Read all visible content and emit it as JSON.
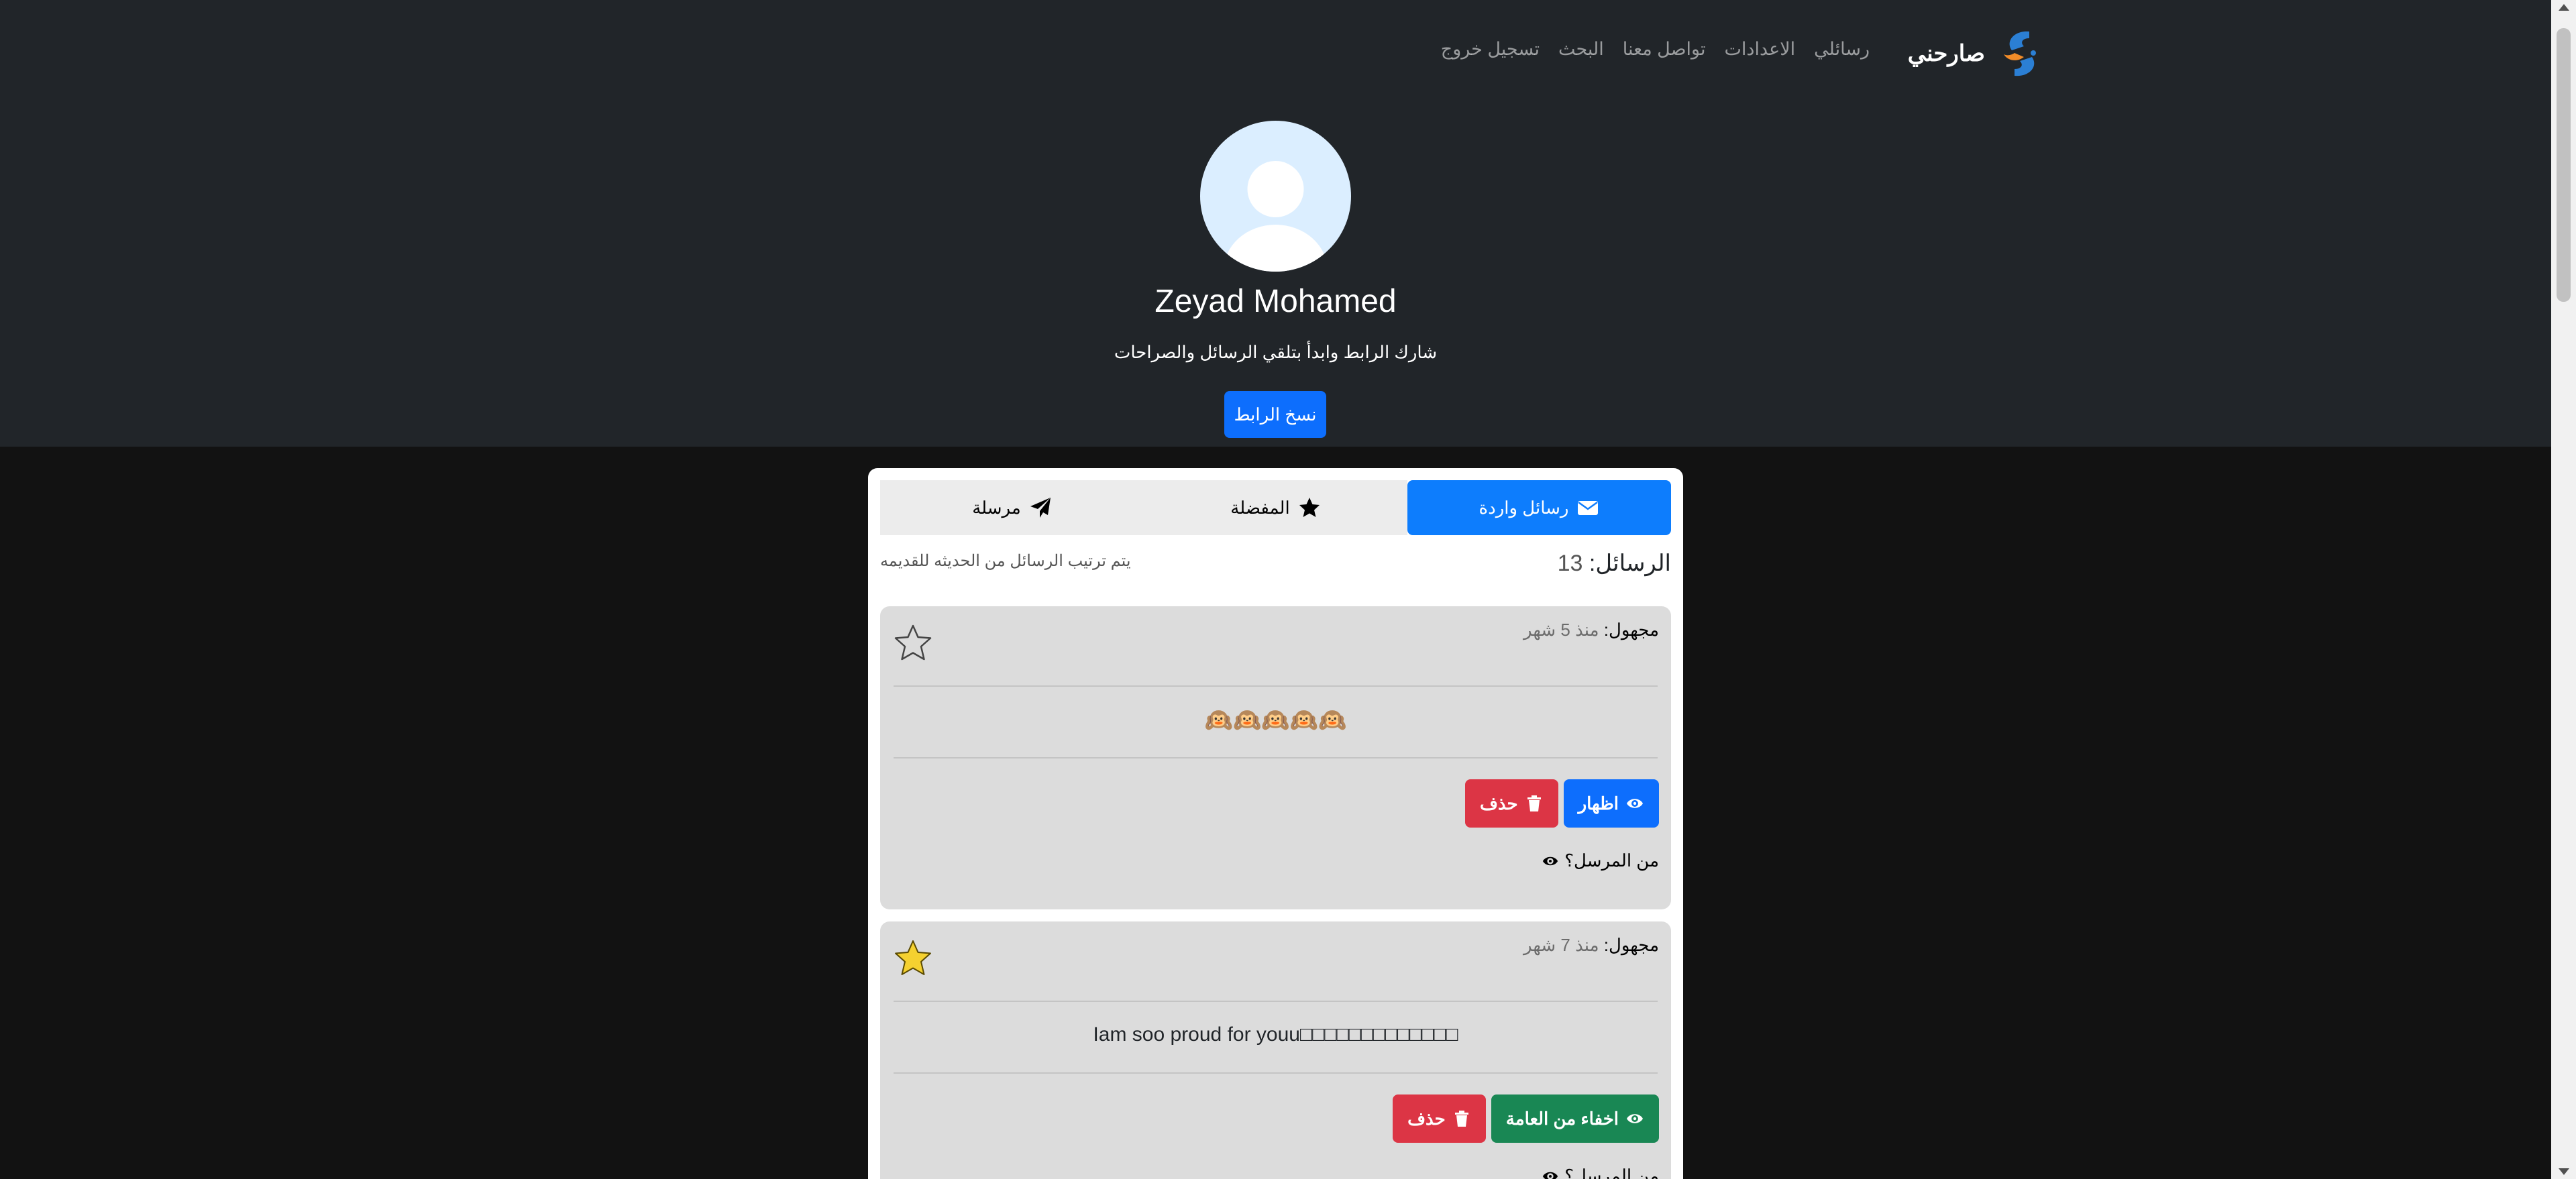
{
  "nav": {
    "brand": "صارحني",
    "links": [
      "رسائلي",
      "الاعدادات",
      "تواصل معنا",
      "البحث",
      "تسجيل خروج"
    ]
  },
  "profile": {
    "name": "Zeyad Mohamed",
    "subtitle": "شارك الرابط وابدأ بتلقي الرسائل والصراحات",
    "copy_label": "نسخ الرابط"
  },
  "tabs": {
    "inbox": "رسائل واردة",
    "favorites": "المفضلة",
    "sent": "مرسلة"
  },
  "messages_summary": {
    "label": "الرسائل:",
    "count": "13",
    "sort_note": "يتم ترتيب الرسائل من الحديثه للقديمه"
  },
  "messages": [
    {
      "sender": "مجهول:",
      "time": "منذ 5 شهر",
      "starred": false,
      "body": "🙉🙉🙉🙉🙉",
      "primary_label": "اظهار",
      "delete_label": "حذف",
      "sender_question": "من المرسل؟"
    },
    {
      "sender": "مجهول:",
      "time": "منذ 7 شهر",
      "starred": true,
      "body": "Iam soo proud for youu□□□□□□□□□□□□□",
      "primary_label": "اخفاء من العامة",
      "delete_label": "حذف",
      "sender_question": "من المرسل؟"
    }
  ],
  "colors": {
    "navbar_bg": "#212529",
    "primary": "#0d6efd",
    "danger": "#dc3545",
    "success": "#198754",
    "star_filled": "#f5d130"
  }
}
